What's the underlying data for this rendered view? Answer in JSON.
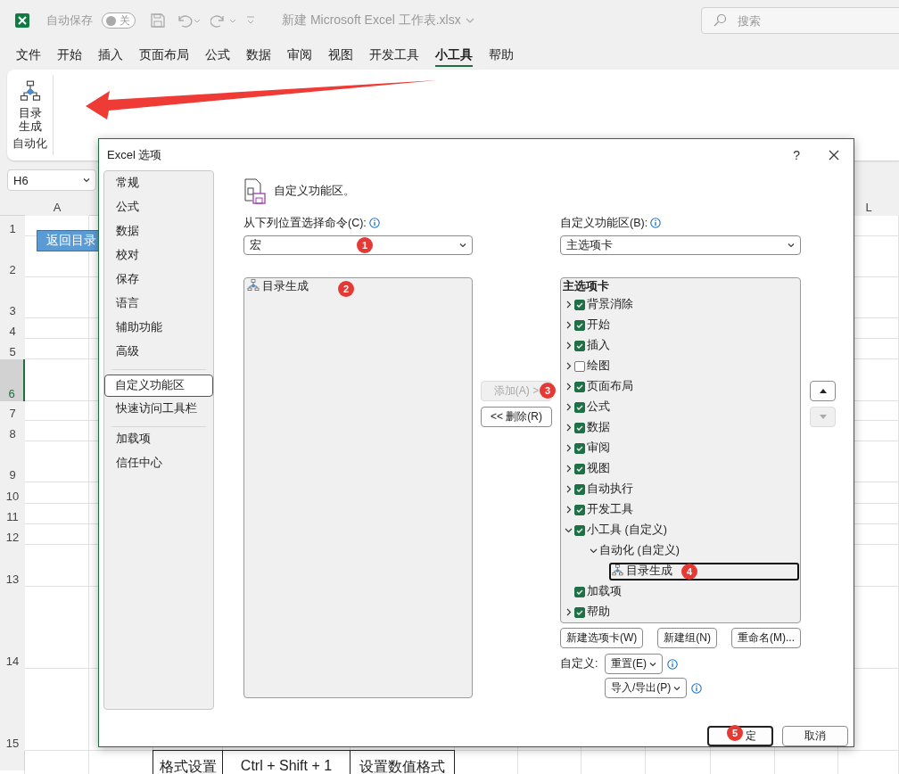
{
  "title_bar": {
    "autosave_label": "自动保存",
    "autosave_toggle": {
      "label": "关",
      "on": false
    },
    "file_name": "新建 Microsoft Excel 工作表.xlsx",
    "search": {
      "placeholder": "搜索"
    }
  },
  "ribbon_tabs": [
    {
      "label": "文件",
      "selected": false
    },
    {
      "label": "开始",
      "selected": false
    },
    {
      "label": "插入",
      "selected": false
    },
    {
      "label": "页面布局",
      "selected": false
    },
    {
      "label": "公式",
      "selected": false
    },
    {
      "label": "数据",
      "selected": false
    },
    {
      "label": "审阅",
      "selected": false
    },
    {
      "label": "视图",
      "selected": false
    },
    {
      "label": "开发工具",
      "selected": false
    },
    {
      "label": "小工具",
      "selected": true
    },
    {
      "label": "帮助",
      "selected": false
    }
  ],
  "ribbon": {
    "groups": [
      {
        "label": "自动化",
        "buttons": [
          {
            "label": "目录生成"
          }
        ]
      }
    ]
  },
  "sheet": {
    "name_box": "H6",
    "column_headers": {
      "first": "A",
      "last": "L"
    },
    "row_headers": [
      {
        "label": "1",
        "selected": false
      },
      {
        "label": "2",
        "selected": false
      },
      {
        "label": "3",
        "selected": false
      },
      {
        "label": "4",
        "selected": false
      },
      {
        "label": "5",
        "selected": false
      },
      {
        "label": "6",
        "selected": true
      },
      {
        "label": "7",
        "selected": false
      },
      {
        "label": "8",
        "selected": false
      },
      {
        "label": "9",
        "selected": false
      },
      {
        "label": "10",
        "selected": false
      },
      {
        "label": "11",
        "selected": false
      },
      {
        "label": "12",
        "selected": false
      },
      {
        "label": "13",
        "selected": false
      },
      {
        "label": "14",
        "selected": false
      },
      {
        "label": "15",
        "selected": false
      }
    ],
    "shape_button": "返回目录",
    "row_16_cells": [
      "格式设置",
      "Ctrl + Shift + 1",
      "设置数值格式"
    ]
  },
  "dialog": {
    "title": "Excel 选项",
    "help_button": "?",
    "nav": {
      "groups": [
        [
          {
            "label": "常规",
            "selected": false
          },
          {
            "label": "公式",
            "selected": false
          },
          {
            "label": "数据",
            "selected": false
          },
          {
            "label": "校对",
            "selected": false
          },
          {
            "label": "保存",
            "selected": false
          },
          {
            "label": "语言",
            "selected": false
          },
          {
            "label": "辅助功能",
            "selected": false
          },
          {
            "label": "高级",
            "selected": false
          }
        ],
        [
          {
            "label": "自定义功能区",
            "selected": true
          },
          {
            "label": "快速访问工具栏",
            "selected": false
          }
        ],
        [
          {
            "label": "加载项",
            "selected": false
          },
          {
            "label": "信任中心",
            "selected": false
          }
        ]
      ]
    },
    "heading": "自定义功能区。",
    "commands": {
      "label": "从下列位置选择命令(C):",
      "dropdown": {
        "value": "宏",
        "badge": "1"
      },
      "list": [
        {
          "label": "目录生成",
          "badge": "2"
        }
      ]
    },
    "add_button": {
      "label": "添加(A) >",
      "disabled": true,
      "badge": "3"
    },
    "remove_button": {
      "label": "<< 删除(R)",
      "disabled": false
    },
    "ribbon_config": {
      "label": "自定义功能区(B):",
      "dropdown": {
        "value": "主选项卡"
      },
      "tree": {
        "header": "主选项卡",
        "items": [
          {
            "kind": "tab",
            "label": "背景消除",
            "checked": true,
            "expandable": true,
            "expanded": false
          },
          {
            "kind": "tab",
            "label": "开始",
            "checked": true,
            "expandable": true,
            "expanded": false
          },
          {
            "kind": "tab",
            "label": "插入",
            "checked": true,
            "expandable": true,
            "expanded": false
          },
          {
            "kind": "tab",
            "label": "绘图",
            "checked": false,
            "expandable": true,
            "expanded": false
          },
          {
            "kind": "tab",
            "label": "页面布局",
            "checked": true,
            "expandable": true,
            "expanded": false
          },
          {
            "kind": "tab",
            "label": "公式",
            "checked": true,
            "expandable": true,
            "expanded": false
          },
          {
            "kind": "tab",
            "label": "数据",
            "checked": true,
            "expandable": true,
            "expanded": false
          },
          {
            "kind": "tab",
            "label": "审阅",
            "checked": true,
            "expandable": true,
            "expanded": false
          },
          {
            "kind": "tab",
            "label": "视图",
            "checked": true,
            "expandable": true,
            "expanded": false
          },
          {
            "kind": "tab",
            "label": "自动执行",
            "checked": true,
            "expandable": true,
            "expanded": false
          },
          {
            "kind": "tab",
            "label": "开发工具",
            "checked": true,
            "expandable": true,
            "expanded": false
          },
          {
            "kind": "tab",
            "label": "小工具 (自定义)",
            "checked": true,
            "expandable": true,
            "expanded": true,
            "children": [
              {
                "kind": "group",
                "label": "自动化 (自定义)",
                "expandable": true,
                "expanded": true,
                "children": [
                  {
                    "kind": "command",
                    "label": "目录生成",
                    "selected": true,
                    "badge": "4"
                  }
                ]
              }
            ]
          },
          {
            "kind": "tab",
            "label": "加载项",
            "checked": true,
            "expandable": false
          },
          {
            "kind": "tab",
            "label": "帮助",
            "checked": true,
            "expandable": true,
            "expanded": false
          }
        ]
      }
    },
    "move_buttons": [
      {
        "kind": "up",
        "disabled": false
      },
      {
        "kind": "down",
        "disabled": true
      }
    ],
    "tree_buttons": [
      "新建选项卡(W)",
      "新建组(N)",
      "重命名(M)..."
    ],
    "customize": {
      "label": "自定义:",
      "buttons": [
        {
          "label": "重置(E)"
        },
        {
          "label": "导入/导出(P)"
        }
      ]
    },
    "footer": [
      {
        "label": "定",
        "default": true,
        "badge": "5"
      },
      {
        "label": "取消",
        "default": false
      }
    ]
  }
}
